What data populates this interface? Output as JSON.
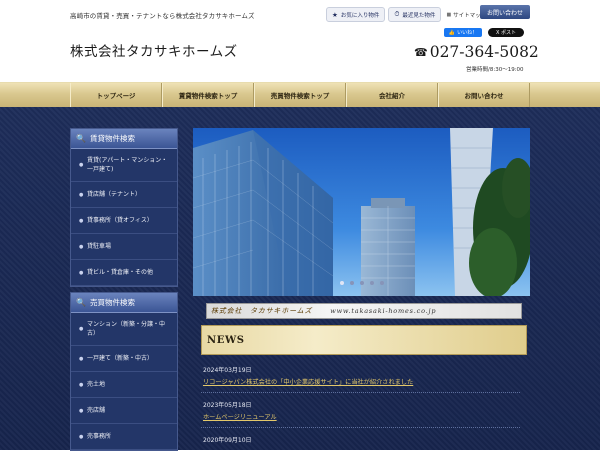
{
  "header": {
    "tagline": "高崎市の賃貸・売買・テナントなら株式会社タカサキホームズ",
    "favorites_label": "お気に入り物件",
    "recent_label": "最近見た物件",
    "sitemap_label": "サイトマップ",
    "contact_label": "お問い合わせ",
    "company_name": "株式会社タカサキホームズ",
    "like_label": "いいね！",
    "post_label": "X ポスト",
    "phone": "027-364-5082",
    "hours": "営業時間/8:30～19:00"
  },
  "nav": {
    "items": [
      "トップページ",
      "賃貸物件検索トップ",
      "売買物件検索トップ",
      "会社紹介",
      "お問い合わせ"
    ]
  },
  "sidebar": {
    "rental": {
      "title": "賃貸物件検索",
      "items": [
        "賃貸(アパート・マンション・一戸建て)",
        "貸店舗（テナント）",
        "貸事務所（貸オフィス）",
        "貸駐車場",
        "貸ビル・貸倉庫・その他"
      ]
    },
    "sale": {
      "title": "売買物件検索",
      "items": [
        "マンション（新築・分譲・中古）",
        "一戸建て（新築・中古）",
        "売土地",
        "売店舗",
        "売事務所"
      ]
    }
  },
  "hero": {
    "slide_count": 5,
    "active_slide": 1
  },
  "banner": {
    "text": "株式会社　タカサキホームズ",
    "url": "www.takasaki-homes.co.jp"
  },
  "news": {
    "heading": "NEWS",
    "items": [
      {
        "date": "2024年03月19日",
        "title": "リコージャパン株式会社の「中小企業応援サイト」に当社が紹介されました"
      },
      {
        "date": "2023年05月18日",
        "title": "ホームページリニューアル"
      },
      {
        "date": "2020年09月10日",
        "title": ""
      }
    ]
  },
  "colors": {
    "navy": "#1d2d5a",
    "gold": "#d9c88f",
    "link_gold": "#e3c86a",
    "accent_blue": "#3b5595"
  }
}
